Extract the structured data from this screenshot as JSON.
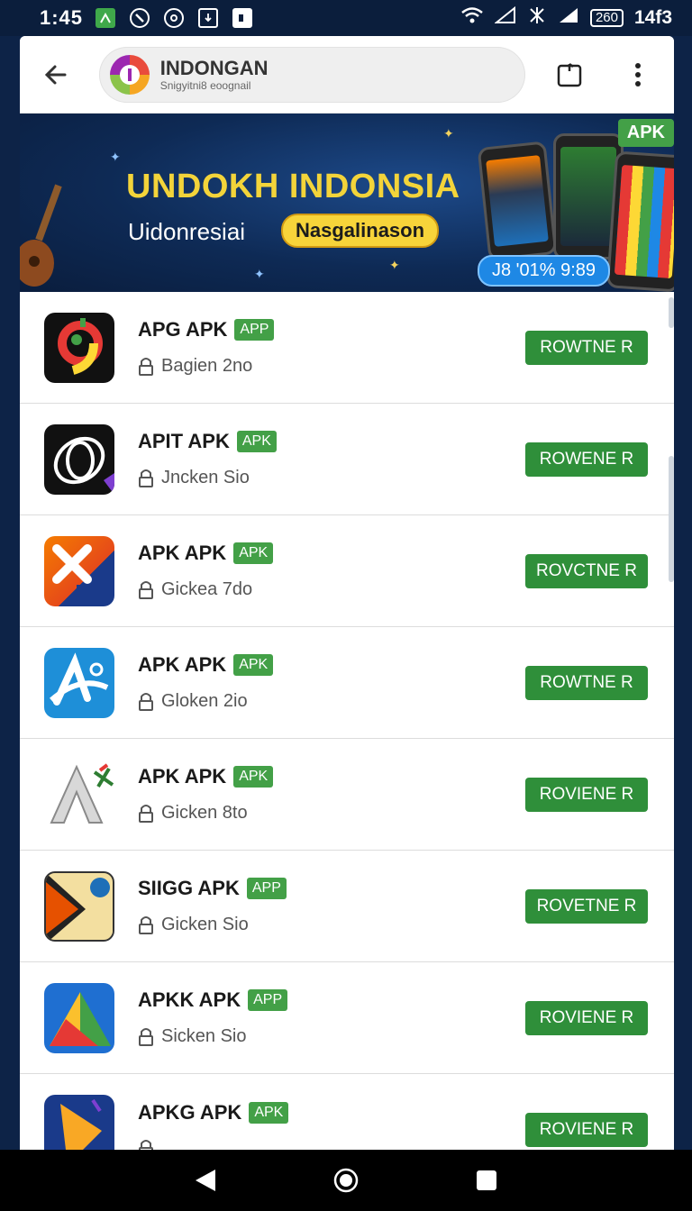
{
  "status_bar": {
    "time": "1:45",
    "right_time": "14f3",
    "battery": "260"
  },
  "header": {
    "title": "INDONGAN",
    "subtitle": "Snigyitni8 eoognail"
  },
  "banner": {
    "title": "UNDOKH INDONSIA",
    "subtitle": "Uidonresiai",
    "pill": "Nasgalinason",
    "apk_tag": "APK",
    "chip": "J8 '01% 9:89"
  },
  "apps": [
    {
      "name": "APG APK",
      "badge": "APP",
      "subtitle": "Bagien 2no",
      "button": "ROWTNE R",
      "icon": "colorful-nine-app-icon"
    },
    {
      "name": "APIT APK",
      "badge": "APK",
      "subtitle": "Jncken Sio",
      "button": "ROWENE R",
      "icon": "swirl-logo-app-icon"
    },
    {
      "name": "APK APK",
      "badge": "APK",
      "subtitle": "Gickea 7do",
      "button": "ROVCTNE R",
      "icon": "orange-x-app-icon"
    },
    {
      "name": "APK APK",
      "badge": "APK",
      "subtitle": "Gloken 2io",
      "button": "ROWTNE R",
      "icon": "blue-a-app-icon"
    },
    {
      "name": "APK APK",
      "badge": "APK",
      "subtitle": "Gicken 8to",
      "button": "ROVIENE R",
      "icon": "silver-a-app-icon"
    },
    {
      "name": "SIIGG APK",
      "badge": "APP",
      "subtitle": "Gicken Sio",
      "button": "ROVETNE R",
      "icon": "ncl-arrow-app-icon"
    },
    {
      "name": "APKK APK",
      "badge": "APP",
      "subtitle": "Sicken Sio",
      "button": "ROVIENE R",
      "icon": "play-triangle-app-icon"
    },
    {
      "name": "APKG APK",
      "badge": "APK",
      "subtitle": "",
      "button": "ROVIENE R",
      "icon": "gold-arrow-app-icon"
    }
  ],
  "colors": {
    "accent_green": "#2f8f3a",
    "badge_green": "#43a047",
    "banner_yellow": "#f3d43a",
    "background_navy": "#0d2347"
  }
}
